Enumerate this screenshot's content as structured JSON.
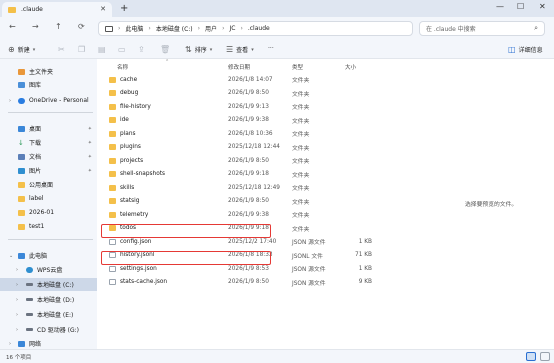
{
  "window": {
    "tab_title": ".claude",
    "new_tab": "+",
    "controls": {
      "minimize": "—",
      "maximize": "☐",
      "close": "✕"
    }
  },
  "nav": {
    "back": "←",
    "forward": "→",
    "up": "↑",
    "refresh": "⟳",
    "breadcrumbs": [
      "此电脑",
      "本地磁盘 (C:)",
      "用户",
      "JC",
      ".claude"
    ],
    "search_placeholder": "在 .claude 中搜索"
  },
  "toolbar": {
    "new_label": "新建",
    "sort_label": "排序",
    "view_label": "查看",
    "more_label": "···",
    "details_label": "详细信息"
  },
  "sidebar": {
    "items": [
      {
        "label": "主文件夹",
        "color": "#e9973a"
      },
      {
        "label": "图库",
        "color": "#4a8fd8"
      },
      {
        "label": "OneDrive - Personal",
        "color": "#2a7de1"
      },
      {
        "label": "桌面",
        "color": "#3b87d8"
      },
      {
        "label": "下载",
        "color": "#2f9a5a"
      },
      {
        "label": "文档",
        "color": "#5b7fb8"
      },
      {
        "label": "图片",
        "color": "#2f8fd0"
      },
      {
        "label": "公用桌面",
        "color": "#f4c04a"
      },
      {
        "label": "label",
        "color": "#f4c04a"
      },
      {
        "label": "2026-01",
        "color": "#f4c04a"
      },
      {
        "label": "test1",
        "color": "#f4c04a"
      },
      {
        "label": "此电脑",
        "color": "#3b87d8"
      },
      {
        "label": "WPS云盘",
        "color": "#2f8fd0"
      },
      {
        "label": "本地磁盘 (C:)",
        "color": "#6b7380"
      },
      {
        "label": "本地磁盘 (D:)",
        "color": "#6b7380"
      },
      {
        "label": "本地磁盘 (E:)",
        "color": "#6b7380"
      },
      {
        "label": "CD 驱动器 (G:)",
        "color": "#6b7380"
      },
      {
        "label": "网络",
        "color": "#3b87d8"
      }
    ]
  },
  "columns": {
    "name": "名称",
    "date": "修改日期",
    "type": "类型",
    "size": "大小"
  },
  "files": [
    {
      "name": "cache",
      "date": "2026/1/8 14:07",
      "type": "文件夹",
      "size": "",
      "kind": "folder"
    },
    {
      "name": "debug",
      "date": "2026/1/9 8:50",
      "type": "文件夹",
      "size": "",
      "kind": "folder"
    },
    {
      "name": "file-history",
      "date": "2026/1/9 9:13",
      "type": "文件夹",
      "size": "",
      "kind": "folder"
    },
    {
      "name": "ide",
      "date": "2026/1/9 9:38",
      "type": "文件夹",
      "size": "",
      "kind": "folder"
    },
    {
      "name": "plans",
      "date": "2026/1/8 10:36",
      "type": "文件夹",
      "size": "",
      "kind": "folder"
    },
    {
      "name": "plugins",
      "date": "2025/12/18 12:44",
      "type": "文件夹",
      "size": "",
      "kind": "folder"
    },
    {
      "name": "projects",
      "date": "2026/1/9 8:50",
      "type": "文件夹",
      "size": "",
      "kind": "folder"
    },
    {
      "name": "shell-snapshots",
      "date": "2026/1/9 9:18",
      "type": "文件夹",
      "size": "",
      "kind": "folder"
    },
    {
      "name": "skills",
      "date": "2025/12/18 12:49",
      "type": "文件夹",
      "size": "",
      "kind": "folder"
    },
    {
      "name": "statsig",
      "date": "2026/1/9 8:50",
      "type": "文件夹",
      "size": "",
      "kind": "folder"
    },
    {
      "name": "telemetry",
      "date": "2026/1/9 9:38",
      "type": "文件夹",
      "size": "",
      "kind": "folder"
    },
    {
      "name": "todos",
      "date": "2026/1/9 9:18",
      "type": "文件夹",
      "size": "",
      "kind": "folder"
    },
    {
      "name": "config.json",
      "date": "2025/12/2 17:40",
      "type": "JSON 源文件",
      "size": "1 KB",
      "kind": "file"
    },
    {
      "name": "history.jsonl",
      "date": "2026/1/8 18:33",
      "type": "JSONL 文件",
      "size": "71 KB",
      "kind": "file"
    },
    {
      "name": "settings.json",
      "date": "2026/1/9 8:53",
      "type": "JSON 源文件",
      "size": "1 KB",
      "kind": "file"
    },
    {
      "name": "stats-cache.json",
      "date": "2026/1/9 8:50",
      "type": "JSON 源文件",
      "size": "9 KB",
      "kind": "file"
    }
  ],
  "preview_message": "选择要预览的文件。",
  "status": {
    "item_count": "16 个项目"
  },
  "colors": {
    "folder": "#f4c04a",
    "highlight": "#e53935",
    "selected": "#cdd8e8"
  }
}
